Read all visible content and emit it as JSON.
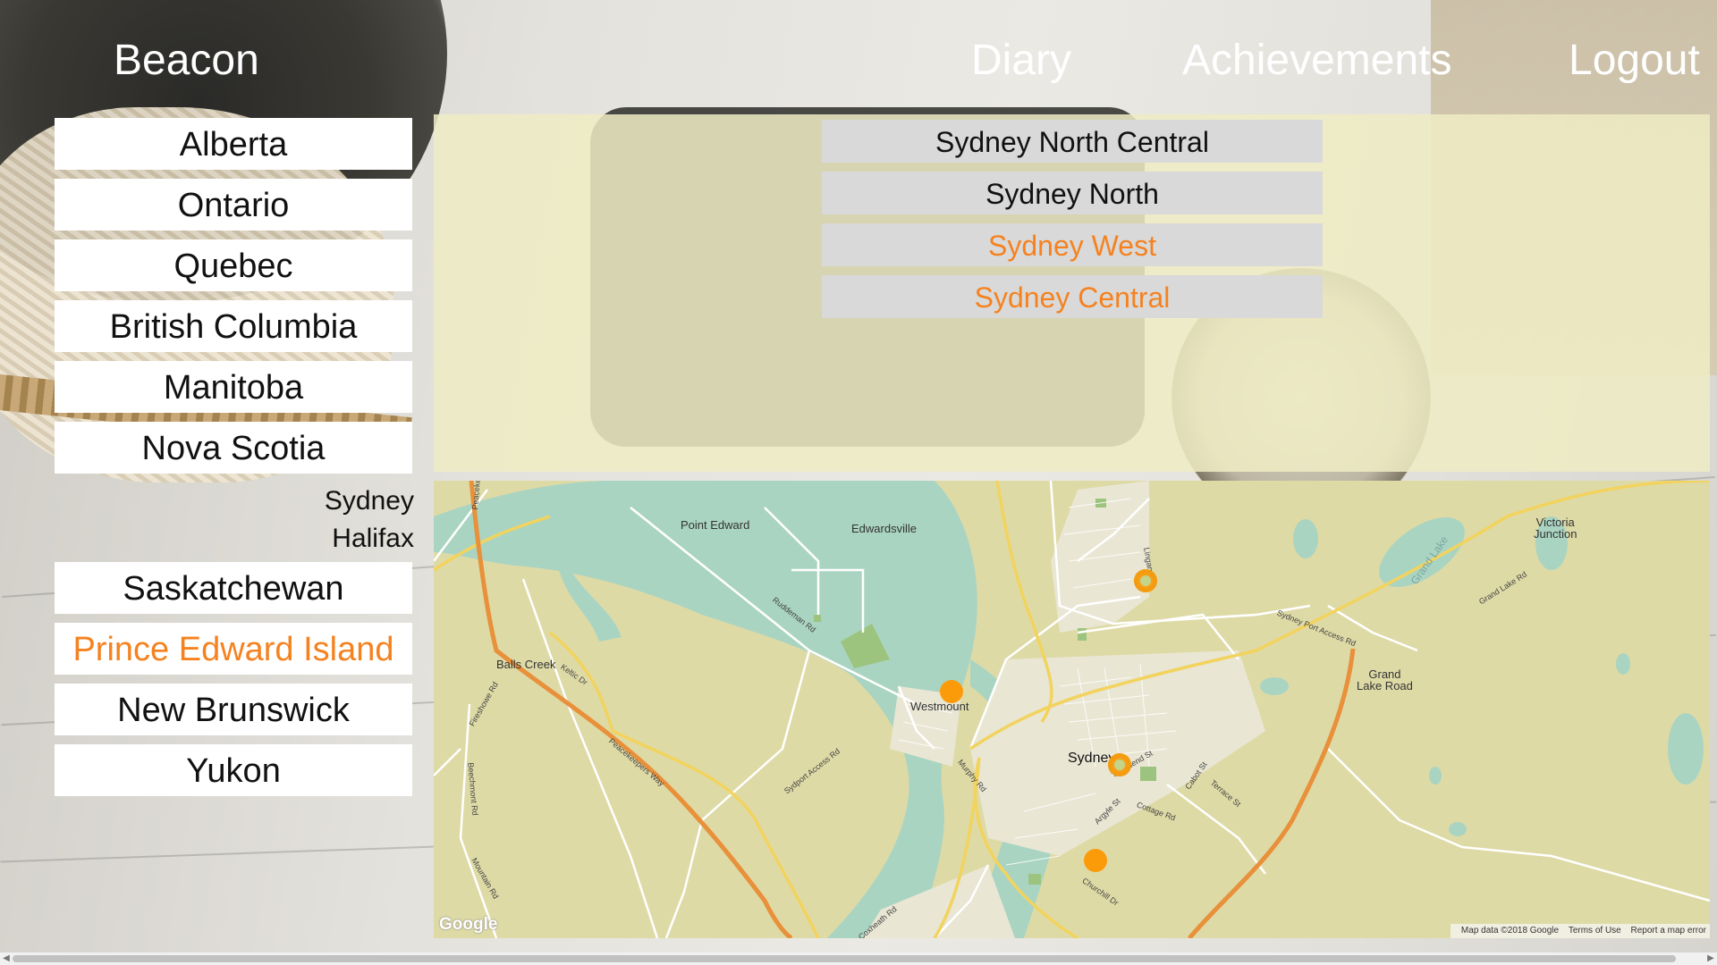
{
  "header": {
    "brand": "Beacon",
    "nav": {
      "diary": "Diary",
      "achievements": "Achievements",
      "logout": "Logout"
    }
  },
  "provinces": [
    {
      "label": "Alberta"
    },
    {
      "label": "Ontario"
    },
    {
      "label": "Quebec"
    },
    {
      "label": "British Columbia"
    },
    {
      "label": "Manitoba"
    },
    {
      "label": "Nova Scotia",
      "expanded": true,
      "cities": [
        "Sydney",
        "Halifax"
      ]
    },
    {
      "label": "Saskatchewan"
    },
    {
      "label": "Prince Edward Island",
      "highlighted": true
    },
    {
      "label": "New Brunswick"
    },
    {
      "label": "Yukon"
    }
  ],
  "areas": [
    {
      "label": "Sydney North Central",
      "highlighted": false
    },
    {
      "label": "Sydney North",
      "highlighted": false
    },
    {
      "label": "Sydney West",
      "highlighted": true
    },
    {
      "label": "Sydney Central",
      "highlighted": true
    }
  ],
  "map": {
    "places": {
      "point_edward": "Point Edward",
      "edwardsville": "Edwardsville",
      "victoria_junction": "Victoria\nJunction",
      "balls_creek": "Balls Creek",
      "westmount": "Westmount",
      "sydney": "Sydney",
      "grand_lake_road": "Grand\nLake Road"
    },
    "roads": {
      "keltic_dr": "Keltic Dr",
      "peacekeepers_way": "Peacekeepers Way",
      "ruddeman_rd": "Ruddeman Rd",
      "sydport_access_rd": "Sydport Access Rd",
      "murphy_rd": "Murphy Rd",
      "lingan_rd": "Lingan Rd",
      "sydney_port_access_rd": "Sydney Port Access Rd",
      "grand_lake_rd": "Grand Lake Rd",
      "cottage_rd": "Cottage Rd",
      "terrace_st": "Terrace St",
      "cabot_st": "Cabot St",
      "argyle_st": "Argyle St",
      "churchill_dr": "Churchill Dr",
      "coxheath_rd": "Coxheath Rd",
      "mountain_rd": "Mountain Rd",
      "beechmont_rd": "Beechmont Rd",
      "fireshowe_rd": "Fireshowe Rd",
      "peacek": "Peaceke",
      "townsend_st": "Townsend St"
    },
    "lakes": {
      "grand_lake": "Grand Lake"
    },
    "attribution": {
      "logo": "Google",
      "map_data": "Map data ©2018 Google",
      "terms": "Terms of Use",
      "report": "Report a map error"
    },
    "marker_color": "#fb9b0a"
  },
  "colors": {
    "accent": "#f5821f",
    "panel": "#efecc4",
    "area_button": "#d9d9d9",
    "water": "#aad4c2",
    "land": "#dedaa6"
  }
}
